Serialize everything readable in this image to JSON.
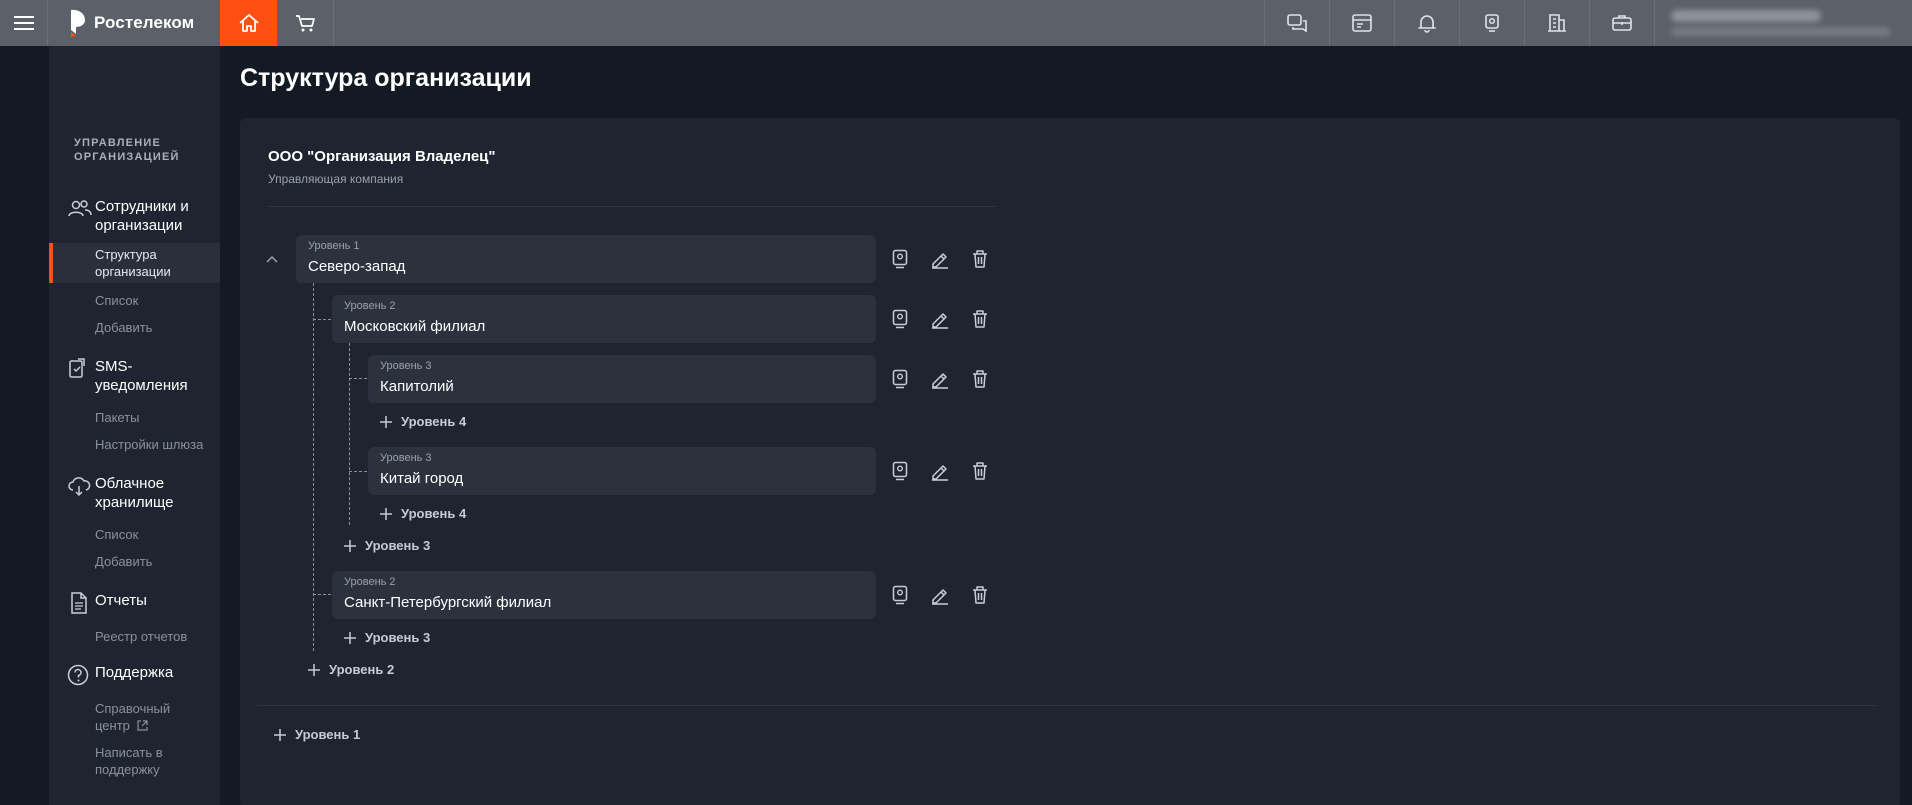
{
  "topbar": {
    "brand": "Ростелеком",
    "icons": [
      "menu-icon",
      "home-icon",
      "cart-icon",
      "chat-icon",
      "billing-icon",
      "bell-icon",
      "camera-icon",
      "building-icon",
      "briefcase-icon"
    ],
    "accent": "#ff4f12"
  },
  "sidebar": {
    "section_title": "УПРАВЛЕНИЕ ОРГАНИЗАЦИЕЙ",
    "groups": [
      {
        "label": "Сотрудники и организации",
        "icon": "people-icon",
        "items": [
          "Структура организации",
          "Список",
          "Добавить"
        ]
      },
      {
        "label": "SMS-уведомления",
        "icon": "sms-icon",
        "items": [
          "Пакеты",
          "Настройки шлюза"
        ]
      },
      {
        "label": "Облачное хранилище",
        "icon": "cloud-icon",
        "items": [
          "Список",
          "Добавить"
        ]
      },
      {
        "label": "Отчеты",
        "icon": "document-icon",
        "items": [
          "Реестр отчетов"
        ]
      },
      {
        "label": "Поддержка",
        "icon": "help-icon",
        "items": [
          "Справочный центр",
          "Написать в поддержку"
        ]
      }
    ],
    "active_item": "Структура организации"
  },
  "main": {
    "title": "Структура организации",
    "org": {
      "name": "ООО \"Организация Владелец\"",
      "type": "Управляющая компания"
    },
    "nodes": [
      {
        "level": "Уровень 1",
        "name": "Северо-запад"
      },
      {
        "level": "Уровень 2",
        "name": "Московский филиал"
      },
      {
        "level": "Уровень 3",
        "name": "Капитолий"
      },
      {
        "level": "Уровень 3",
        "name": "Китай город"
      },
      {
        "level": "Уровень 2",
        "name": "Санкт-Петербургский филиал"
      }
    ],
    "add_buttons": {
      "level4a": "Уровень 4",
      "level4b": "Уровень 4",
      "level3a": "Уровень 3",
      "level3b": "Уровень 3",
      "level2": "Уровень 2",
      "level1": "Уровень 1"
    }
  }
}
